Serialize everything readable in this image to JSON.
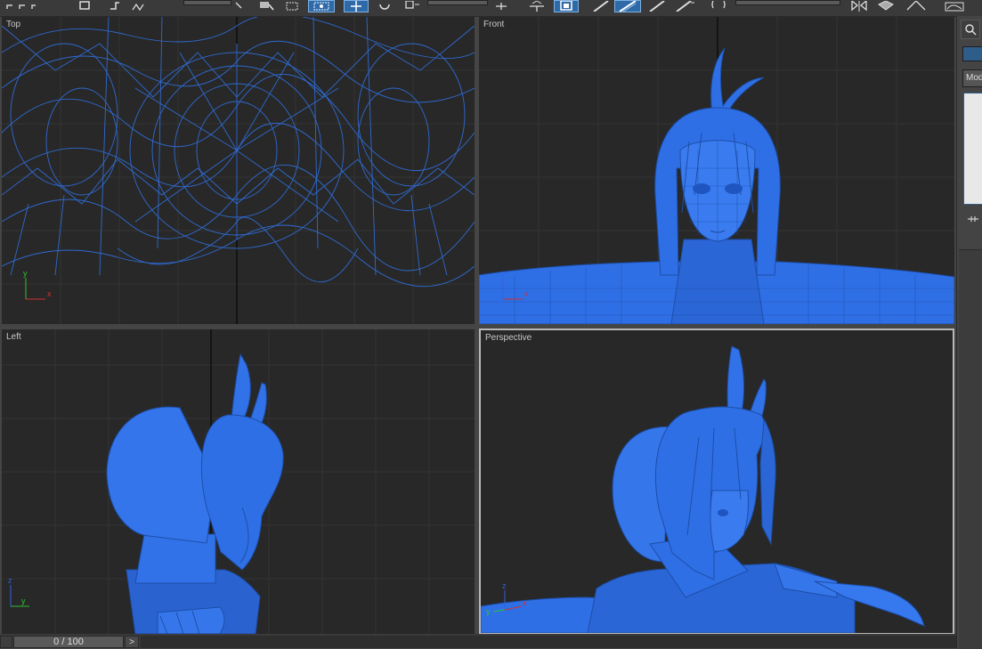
{
  "toolbar": {
    "tools": [
      "undo-icon",
      "redo-icon",
      "select-link-icon",
      "unlink-icon",
      "bind-spacewarp-icon",
      "selection-filter-dropdown",
      "select-object-icon",
      "select-by-name-icon",
      "rectangular-selection-icon",
      "window-crossing-icon",
      "select-move-icon",
      "select-rotate-icon",
      "select-scale-icon",
      "reference-coordinate-dropdown",
      "use-pivot-center-icon",
      "select-manipulate-icon",
      "keyboard-shortcut-override-icon",
      "snaps-toggle-icon",
      "angle-snap-icon",
      "percent-snap-icon",
      "spinner-snap-icon",
      "edit-named-selection-icon",
      "named-selection-dropdown",
      "mirror-icon",
      "align-icon",
      "layer-manager-icon",
      "curve-editor-icon"
    ],
    "active": [
      "window-crossing-icon",
      "select-move-icon",
      "keyboard-shortcut-override-icon",
      "angle-snap-icon"
    ]
  },
  "viewports": {
    "top": {
      "label": "Top"
    },
    "front": {
      "label": "Front"
    },
    "left": {
      "label": "Left"
    },
    "perspective": {
      "label": "Perspective"
    }
  },
  "command_panel": {
    "tabs": [
      "modify-icon"
    ],
    "modifier_list_label": "Mod",
    "pin_icon": "pin-stack-icon"
  },
  "timeline": {
    "position": "0 / 100",
    "next_label": ">"
  },
  "colors": {
    "model_blue": "#2a6fe0",
    "wire_blue": "#3a78d8",
    "viewport_bg": "#282828",
    "active_border": "#b8b8b8",
    "axis_x": "#d03030",
    "axis_y": "#30c030",
    "axis_z": "#3060e0"
  }
}
